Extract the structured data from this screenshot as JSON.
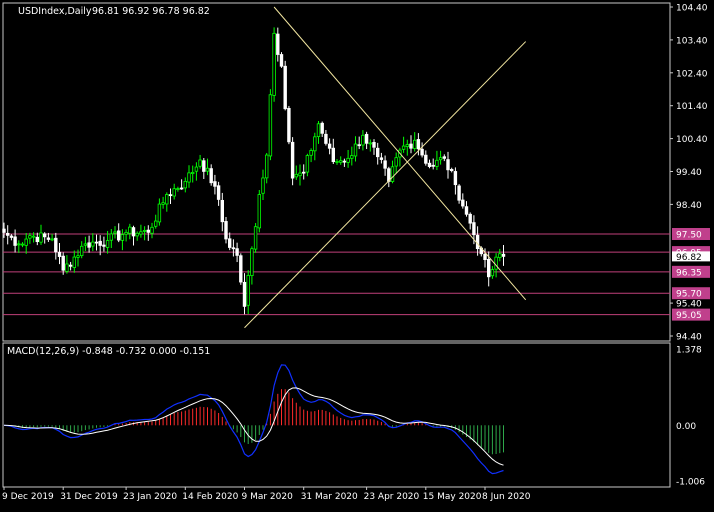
{
  "colors": {
    "background": "#000000",
    "frame": "#c8c8c8",
    "text": "#ffffff",
    "bull": "#00ff00",
    "bear": "#ffffff",
    "trendline": "#f2e6a0",
    "level_line": "#c0407a",
    "level_label_bg": "#c0408c",
    "price_label_bg": "#ffffff",
    "macd_up": "#ff2a2a",
    "macd_down": "#2ea84a",
    "macd_line": "#1030ff",
    "signal_line": "#ffffff"
  },
  "chart_data": [
    {
      "type": "candlestick",
      "title": "USDIndex,Daily",
      "ohlc_header": "96.81 96.92 96.78 96.82",
      "ylim": [
        94.4,
        104.4
      ],
      "y_ticks": [
        "104.40",
        "103.40",
        "102.40",
        "101.40",
        "100.40",
        "99.40",
        "98.40",
        "95.40",
        "94.40"
      ],
      "x_ticks": [
        "9 Dec 2019",
        "31 Dec 2019",
        "23 Jan 2020",
        "14 Feb 2020",
        "9 Mar 2020",
        "31 Mar 2020",
        "23 Apr 2020",
        "15 May 2020",
        "8 Jun 2020"
      ],
      "current_price": "96.82",
      "levels": [
        {
          "label": "97.50",
          "value": 97.5
        },
        {
          "label": "96.95",
          "value": 96.95
        },
        {
          "label": "96.35",
          "value": 96.35
        },
        {
          "label": "95.70",
          "value": 95.7
        },
        {
          "label": "95.05",
          "value": 95.05
        }
      ],
      "trendlines": [
        {
          "from": {
            "date": "2020-03-19",
            "price": 104.4
          },
          "to": {
            "date": "2020-06-23",
            "price": 95.5
          }
        },
        {
          "from": {
            "date": "2020-03-09",
            "price": 94.65
          },
          "to": {
            "date": "2020-06-23",
            "price": 103.35
          }
        }
      ],
      "close_anchors": [
        [
          "2019-12-09",
          97.55
        ],
        [
          "2019-12-13",
          97.2
        ],
        [
          "2019-12-18",
          97.45
        ],
        [
          "2019-12-26",
          97.35
        ],
        [
          "2019-12-31",
          96.4
        ],
        [
          "2020-01-08",
          97.2
        ],
        [
          "2020-01-16",
          97.3
        ],
        [
          "2020-01-23",
          97.55
        ],
        [
          "2020-01-31",
          97.55
        ],
        [
          "2020-02-07",
          98.7
        ],
        [
          "2020-02-14",
          99.1
        ],
        [
          "2020-02-20",
          99.75
        ],
        [
          "2020-02-26",
          98.95
        ],
        [
          "2020-03-02",
          97.35
        ],
        [
          "2020-03-05",
          96.85
        ],
        [
          "2020-03-09",
          95.3
        ],
        [
          "2020-03-13",
          98.7
        ],
        [
          "2020-03-17",
          99.9
        ],
        [
          "2020-03-19",
          103.6
        ],
        [
          "2020-03-23",
          102.6
        ],
        [
          "2020-03-26",
          99.2
        ],
        [
          "2020-03-31",
          99.35
        ],
        [
          "2020-04-06",
          100.85
        ],
        [
          "2020-04-10",
          99.7
        ],
        [
          "2020-04-16",
          99.8
        ],
        [
          "2020-04-22",
          100.5
        ],
        [
          "2020-04-28",
          99.85
        ],
        [
          "2020-05-01",
          99.1
        ],
        [
          "2020-05-06",
          100.05
        ],
        [
          "2020-05-12",
          100.35
        ],
        [
          "2020-05-18",
          99.55
        ],
        [
          "2020-05-22",
          99.8
        ],
        [
          "2020-05-27",
          99.0
        ],
        [
          "2020-06-01",
          98.1
        ],
        [
          "2020-06-05",
          96.9
        ],
        [
          "2020-06-09",
          96.2
        ],
        [
          "2020-06-12",
          96.9
        ],
        [
          "2020-06-15",
          96.82
        ]
      ]
    },
    {
      "type": "macd",
      "title": "MACD(12,26,9) -0.848 -0.732 0.000 -0.151",
      "params": [
        12,
        26,
        9
      ],
      "ylim": [
        -1.006,
        1.378
      ],
      "y_ticks": [
        "1.378",
        "0.00",
        "-1.006"
      ]
    }
  ]
}
